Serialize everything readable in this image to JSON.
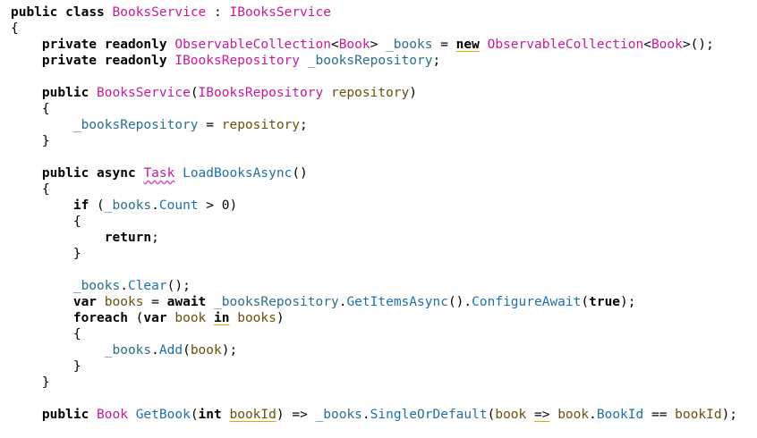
{
  "lines": [
    [
      [
        "kw",
        "public"
      ],
      [
        "pun",
        " "
      ],
      [
        "kw",
        "class"
      ],
      [
        "pun",
        " "
      ],
      [
        "typ",
        "BooksService"
      ],
      [
        "pun",
        " : "
      ],
      [
        "typ",
        "IBooksService"
      ]
    ],
    [
      [
        "pun",
        "{"
      ]
    ],
    [
      [
        "pun",
        "    "
      ],
      [
        "kw",
        "private"
      ],
      [
        "pun",
        " "
      ],
      [
        "kw",
        "readonly"
      ],
      [
        "pun",
        " "
      ],
      [
        "typ",
        "ObservableCollection"
      ],
      [
        "pun",
        "<"
      ],
      [
        "typ",
        "Book"
      ],
      [
        "pun",
        "> "
      ],
      [
        "fld",
        "_books"
      ],
      [
        "pun",
        " = "
      ],
      [
        "kw",
        "new",
        "u-yellow"
      ],
      [
        "pun",
        " "
      ],
      [
        "typ",
        "ObservableCollection"
      ],
      [
        "pun",
        "<"
      ],
      [
        "typ",
        "Book"
      ],
      [
        "pun",
        ">();"
      ]
    ],
    [
      [
        "pun",
        "    "
      ],
      [
        "kw",
        "private"
      ],
      [
        "pun",
        " "
      ],
      [
        "kw",
        "readonly"
      ],
      [
        "pun",
        " "
      ],
      [
        "typ",
        "IBooksRepository"
      ],
      [
        "pun",
        " "
      ],
      [
        "fld",
        "_booksRepository"
      ],
      [
        "pun",
        ";"
      ]
    ],
    [],
    [
      [
        "pun",
        "    "
      ],
      [
        "kw",
        "public"
      ],
      [
        "pun",
        " "
      ],
      [
        "typ",
        "BooksService"
      ],
      [
        "pun",
        "("
      ],
      [
        "typ",
        "IBooksRepository"
      ],
      [
        "pun",
        " "
      ],
      [
        "loc",
        "repository"
      ],
      [
        "pun",
        ")"
      ]
    ],
    [
      [
        "pun",
        "    {"
      ]
    ],
    [
      [
        "pun",
        "        "
      ],
      [
        "fld",
        "_booksRepository"
      ],
      [
        "pun",
        " = "
      ],
      [
        "loc",
        "repository"
      ],
      [
        "pun",
        ";"
      ]
    ],
    [
      [
        "pun",
        "    }"
      ]
    ],
    [],
    [
      [
        "pun",
        "    "
      ],
      [
        "kw",
        "public"
      ],
      [
        "pun",
        " "
      ],
      [
        "kw",
        "async"
      ],
      [
        "pun",
        " "
      ],
      [
        "typ",
        "Task",
        "u-squiggle"
      ],
      [
        "pun",
        " "
      ],
      [
        "mth",
        "LoadBooksAsync"
      ],
      [
        "pun",
        "()"
      ]
    ],
    [
      [
        "pun",
        "    {"
      ]
    ],
    [
      [
        "pun",
        "        "
      ],
      [
        "kw",
        "if"
      ],
      [
        "pun",
        " ("
      ],
      [
        "fld",
        "_books"
      ],
      [
        "pun",
        "."
      ],
      [
        "mth",
        "Count"
      ],
      [
        "pun",
        " > 0)"
      ]
    ],
    [
      [
        "pun",
        "        {"
      ]
    ],
    [
      [
        "pun",
        "            "
      ],
      [
        "kw",
        "return"
      ],
      [
        "pun",
        ";"
      ]
    ],
    [
      [
        "pun",
        "        }"
      ]
    ],
    [],
    [
      [
        "pun",
        "        "
      ],
      [
        "fld",
        "_books"
      ],
      [
        "pun",
        "."
      ],
      [
        "mth",
        "Clear"
      ],
      [
        "pun",
        "();"
      ]
    ],
    [
      [
        "pun",
        "        "
      ],
      [
        "kw",
        "var"
      ],
      [
        "pun",
        " "
      ],
      [
        "loc",
        "books"
      ],
      [
        "pun",
        " = "
      ],
      [
        "kw",
        "await"
      ],
      [
        "pun",
        " "
      ],
      [
        "fld",
        "_booksRepository"
      ],
      [
        "pun",
        "."
      ],
      [
        "mth",
        "GetItemsAsync"
      ],
      [
        "pun",
        "()."
      ],
      [
        "mth",
        "ConfigureAwait"
      ],
      [
        "pun",
        "("
      ],
      [
        "kw",
        "true"
      ],
      [
        "pun",
        ");"
      ]
    ],
    [
      [
        "pun",
        "        "
      ],
      [
        "kw",
        "foreach"
      ],
      [
        "pun",
        " ("
      ],
      [
        "kw",
        "var"
      ],
      [
        "pun",
        " "
      ],
      [
        "loc",
        "book"
      ],
      [
        "pun",
        " "
      ],
      [
        "kw",
        "in",
        "u-yellow"
      ],
      [
        "pun",
        " "
      ],
      [
        "loc",
        "books"
      ],
      [
        "pun",
        ")"
      ]
    ],
    [
      [
        "pun",
        "        {"
      ]
    ],
    [
      [
        "pun",
        "            "
      ],
      [
        "fld",
        "_books"
      ],
      [
        "pun",
        "."
      ],
      [
        "mth",
        "Add"
      ],
      [
        "pun",
        "("
      ],
      [
        "loc",
        "book"
      ],
      [
        "pun",
        ");"
      ]
    ],
    [
      [
        "pun",
        "        }"
      ]
    ],
    [
      [
        "pun",
        "    }"
      ]
    ],
    [],
    [
      [
        "pun",
        "    "
      ],
      [
        "kw",
        "public"
      ],
      [
        "pun",
        " "
      ],
      [
        "typ",
        "Book"
      ],
      [
        "pun",
        " "
      ],
      [
        "mth",
        "GetBook"
      ],
      [
        "pun",
        "("
      ],
      [
        "kw",
        "int"
      ],
      [
        "pun",
        " "
      ],
      [
        "loc",
        "bookId",
        "u-yellow"
      ],
      [
        "pun",
        ") => "
      ],
      [
        "fld",
        "_books"
      ],
      [
        "pun",
        "."
      ],
      [
        "mth",
        "SingleOrDefault"
      ],
      [
        "pun",
        "("
      ],
      [
        "loc",
        "book"
      ],
      [
        "pun",
        " "
      ],
      [
        "pun",
        "=>",
        "u-yellow"
      ],
      [
        "pun",
        " "
      ],
      [
        "loc",
        "book"
      ],
      [
        "pun",
        "."
      ],
      [
        "mth",
        "BookId"
      ],
      [
        "pun",
        " == "
      ],
      [
        "loc",
        "bookId"
      ],
      [
        "pun",
        ");"
      ]
    ]
  ]
}
